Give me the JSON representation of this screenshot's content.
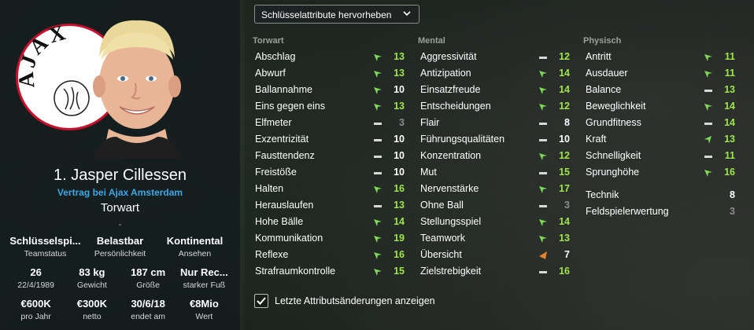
{
  "player": {
    "name": "1. Jasper Cillessen",
    "contract": "Vertrag bei Ajax Amsterdam",
    "position": "Torwart",
    "dash": "-",
    "club_logo_text": "AJAX",
    "info": [
      [
        {
          "value": "Schlüsselspi...",
          "label": "Teamstatus"
        },
        {
          "value": "Belastbar",
          "label": "Persönlichkeit"
        },
        {
          "value": "Kontinental",
          "label": "Ansehen"
        }
      ],
      [
        {
          "value": "26",
          "label": "22/4/1989"
        },
        {
          "value": "83 kg",
          "label": "Gewicht"
        },
        {
          "value": "187 cm",
          "label": "Größe"
        },
        {
          "value": "Nur Rec...",
          "label": "starker Fuß"
        }
      ],
      [
        {
          "value": "€600K",
          "label": "pro Jahr"
        },
        {
          "value": "€300K",
          "label": "netto"
        },
        {
          "value": "30/6/18",
          "label": "endet am"
        },
        {
          "value": "€8Mio",
          "label": "Wert"
        }
      ]
    ]
  },
  "dropdown": {
    "label": "Schlüsselattribute hervorheben"
  },
  "columns": [
    {
      "header": "Torwart",
      "attributes": [
        {
          "name": "Abschlag",
          "value": "13",
          "trend": "up",
          "tone": "green"
        },
        {
          "name": "Abwurf",
          "value": "13",
          "trend": "up",
          "tone": "green"
        },
        {
          "name": "Ballannahme",
          "value": "10",
          "trend": "up",
          "tone": "white"
        },
        {
          "name": "Eins gegen eins",
          "value": "13",
          "trend": "up",
          "tone": "green"
        },
        {
          "name": "Elfmeter",
          "value": "3",
          "trend": "none",
          "tone": "grey"
        },
        {
          "name": "Exzentrizität",
          "value": "10",
          "trend": "none",
          "tone": "white"
        },
        {
          "name": "Fausttendenz",
          "value": "10",
          "trend": "none",
          "tone": "white"
        },
        {
          "name": "Freistöße",
          "value": "10",
          "trend": "none",
          "tone": "white"
        },
        {
          "name": "Halten",
          "value": "16",
          "trend": "up",
          "tone": "green"
        },
        {
          "name": "Herauslaufen",
          "value": "13",
          "trend": "none",
          "tone": "green"
        },
        {
          "name": "Hohe Bälle",
          "value": "14",
          "trend": "up",
          "tone": "green"
        },
        {
          "name": "Kommunikation",
          "value": "19",
          "trend": "up",
          "tone": "green"
        },
        {
          "name": "Reflexe",
          "value": "16",
          "trend": "up",
          "tone": "green"
        },
        {
          "name": "Strafraumkontrolle",
          "value": "15",
          "trend": "up",
          "tone": "green"
        }
      ]
    },
    {
      "header": "Mental",
      "attributes": [
        {
          "name": "Aggressivität",
          "value": "12",
          "trend": "none",
          "tone": "green"
        },
        {
          "name": "Antizipation",
          "value": "14",
          "trend": "up",
          "tone": "green"
        },
        {
          "name": "Einsatzfreude",
          "value": "14",
          "trend": "up",
          "tone": "green"
        },
        {
          "name": "Entscheidungen",
          "value": "12",
          "trend": "up",
          "tone": "green"
        },
        {
          "name": "Flair",
          "value": "8",
          "trend": "none",
          "tone": "white"
        },
        {
          "name": "Führungsqualitäten",
          "value": "10",
          "trend": "none",
          "tone": "white"
        },
        {
          "name": "Konzentration",
          "value": "12",
          "trend": "up",
          "tone": "green"
        },
        {
          "name": "Mut",
          "value": "15",
          "trend": "none",
          "tone": "green"
        },
        {
          "name": "Nervenstärke",
          "value": "17",
          "trend": "up",
          "tone": "green"
        },
        {
          "name": "Ohne Ball",
          "value": "3",
          "trend": "none",
          "tone": "grey"
        },
        {
          "name": "Stellungsspiel",
          "value": "14",
          "trend": "up",
          "tone": "green"
        },
        {
          "name": "Teamwork",
          "value": "13",
          "trend": "up",
          "tone": "green"
        },
        {
          "name": "Übersicht",
          "value": "7",
          "trend": "down",
          "tone": "white"
        },
        {
          "name": "Zielstrebigkeit",
          "value": "16",
          "trend": "none",
          "tone": "green"
        }
      ]
    },
    {
      "header": "Physisch",
      "attributes": [
        {
          "name": "Antritt",
          "value": "11",
          "trend": "up",
          "tone": "green"
        },
        {
          "name": "Ausdauer",
          "value": "11",
          "trend": "up",
          "tone": "green"
        },
        {
          "name": "Balance",
          "value": "13",
          "trend": "none",
          "tone": "green"
        },
        {
          "name": "Beweglichkeit",
          "value": "14",
          "trend": "up",
          "tone": "green"
        },
        {
          "name": "Grundfitness",
          "value": "14",
          "trend": "none",
          "tone": "green"
        },
        {
          "name": "Kraft",
          "value": "13",
          "trend": "up-strong",
          "tone": "green"
        },
        {
          "name": "Schnelligkeit",
          "value": "11",
          "trend": "none",
          "tone": "green"
        },
        {
          "name": "Sprunghöhe",
          "value": "16",
          "trend": "up",
          "tone": "green"
        }
      ]
    }
  ],
  "extra_attributes": [
    {
      "name": "Technik",
      "value": "8",
      "tone": "white"
    },
    {
      "name": "Feldspielerwertung",
      "value": "3",
      "tone": "grey"
    }
  ],
  "checkbox": {
    "label": "Letzte Attributsänderungen anzeigen",
    "checked": true
  },
  "colors": {
    "green": "#9fe64a",
    "contract_blue": "#3fa6e6",
    "arrow_green": "#7ed957",
    "arrow_orange": "#e8822a",
    "ajax_red": "#c8102e"
  }
}
